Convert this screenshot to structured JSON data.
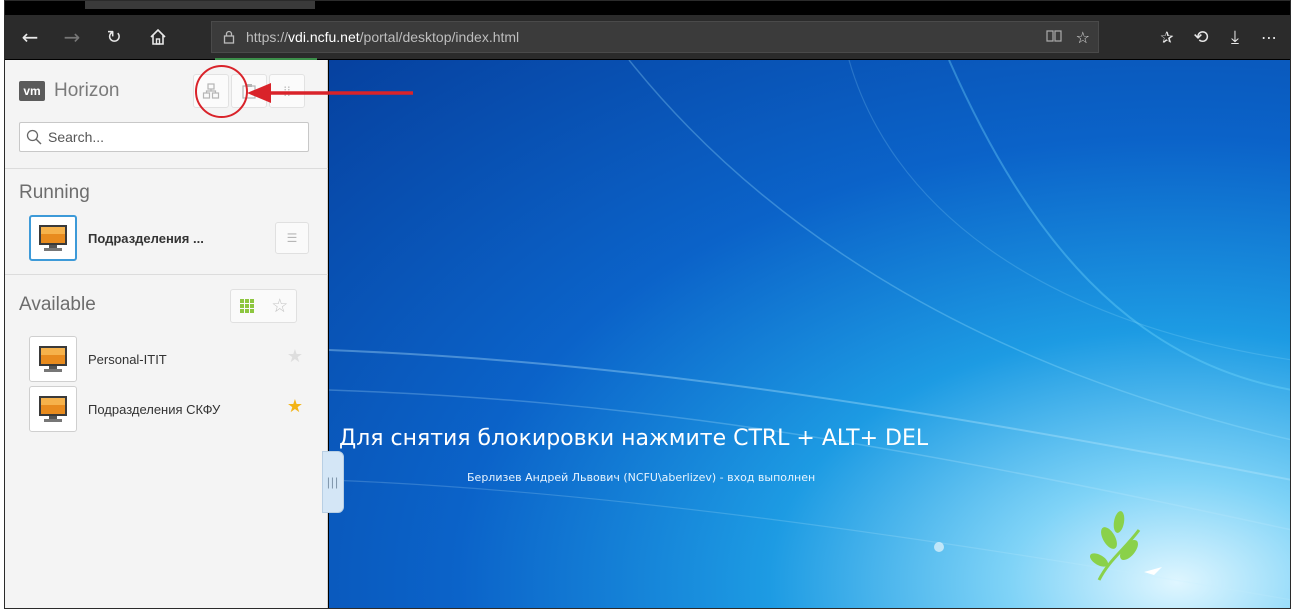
{
  "browser": {
    "url_prefix": "https://",
    "url_host": "vdi.ncfu.net",
    "url_path": "/portal/desktop/index.html",
    "icons": [
      "back-icon",
      "forward-icon",
      "refresh-icon",
      "home-icon",
      "lock-icon",
      "reading-view-icon",
      "favorite-star-icon",
      "favorites-list-icon",
      "history-icon",
      "download-icon",
      "more-icon"
    ]
  },
  "sidebar": {
    "brand_badge": "vm",
    "brand_name": "Horizon",
    "search_placeholder": "Search...",
    "running_title": "Running",
    "running_items": [
      {
        "label": "Подразделения ..."
      }
    ],
    "available_title": "Available",
    "available_items": [
      {
        "label": "Personal-ITIT",
        "favorite": false
      },
      {
        "label": "Подразделения СКФУ",
        "favorite": true
      }
    ]
  },
  "desktop": {
    "lock_message": "Для снятия блокировки нажмите CTRL + ALT+ DEL",
    "user_line": "Берлизев Андрей Львович (NCFU\\aberlizev) - вход выполнен"
  },
  "colors": {
    "annotation": "#d9232a",
    "accent_green": "#8dc63f",
    "favorite_star": "#f3b417",
    "active_border": "#3d9ad8"
  }
}
